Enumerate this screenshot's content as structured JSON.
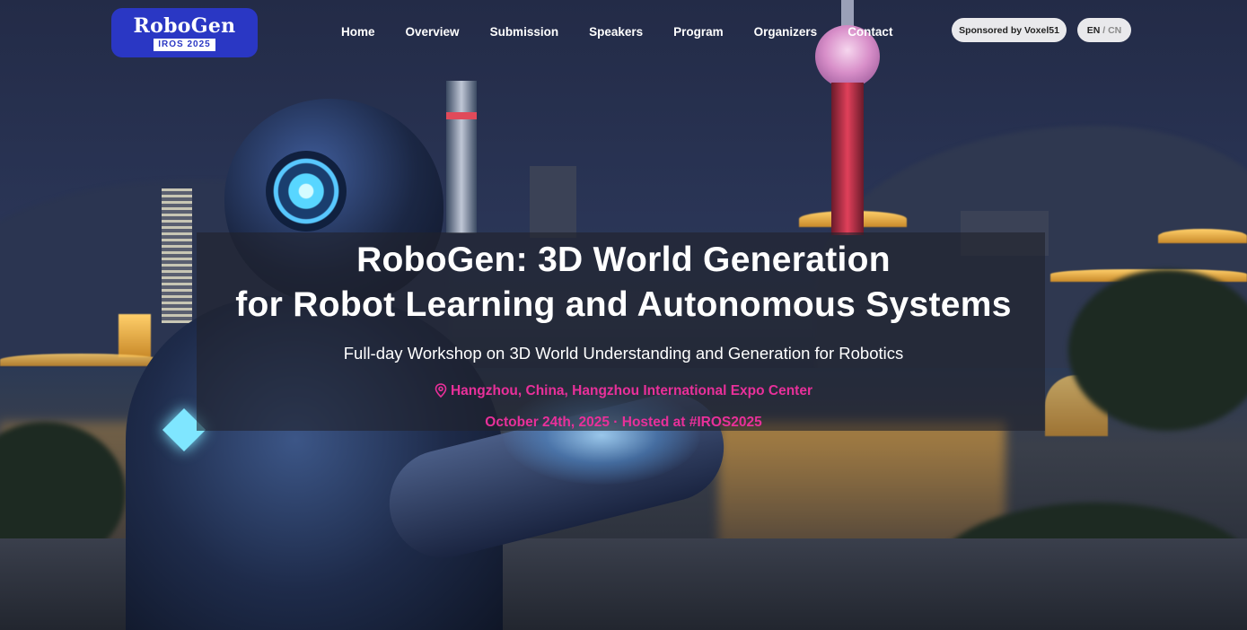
{
  "logo": {
    "title": "RoboGen",
    "subtitle": "IROS 2025"
  },
  "nav": {
    "items": [
      "Home",
      "Overview",
      "Submission",
      "Speakers",
      "Program",
      "Organizers",
      "Contact"
    ]
  },
  "sponsor": {
    "label": "Sponsored by Voxel51"
  },
  "language": {
    "en": "EN",
    "sep": "/",
    "cn": "CN"
  },
  "hero": {
    "title_line1": "RoboGen: 3D World Generation",
    "title_line2": "for Robot Learning and Autonomous Systems",
    "subtitle": "Full-day Workshop on 3D World Understanding and Generation for Robotics",
    "location": "Hangzhou, China, Hangzhou International Expo Center",
    "date": "October 24th, 2025 · Hosted at #IROS2025"
  },
  "colors": {
    "accent_pink": "#e8309a",
    "logo_blue": "#2a37c4"
  }
}
